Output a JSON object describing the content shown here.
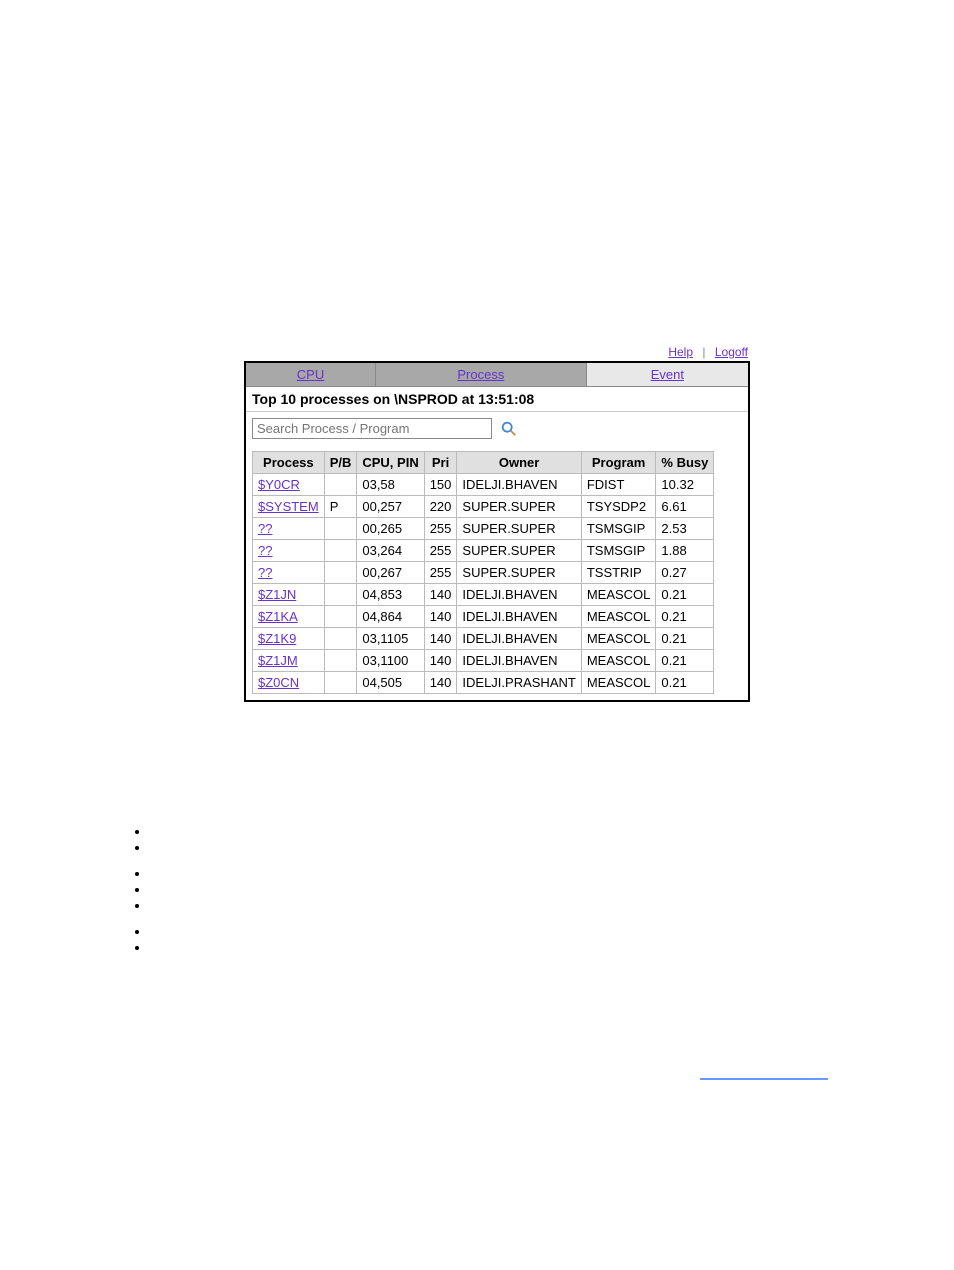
{
  "top_links": {
    "help": "Help",
    "logoff": "Logoff"
  },
  "tabs": {
    "cpu": "CPU",
    "process": "Process",
    "event": "Event"
  },
  "title": "Top 10 processes on \\NSPROD at 13:51:08",
  "search": {
    "placeholder": "Search Process / Program"
  },
  "columns": {
    "process": "Process",
    "pb": "P/B",
    "cpu_pin": "CPU, PIN",
    "pri": "Pri",
    "owner": "Owner",
    "program": "Program",
    "pct_busy": "% Busy"
  },
  "rows": [
    {
      "process": "$Y0CR",
      "pb": "",
      "cpu_pin": "03,58",
      "pri": "150",
      "owner": "IDELJI.BHAVEN",
      "program": "FDIST",
      "pct_busy": "10.32"
    },
    {
      "process": "$SYSTEM",
      "pb": "P",
      "cpu_pin": "00,257",
      "pri": "220",
      "owner": "SUPER.SUPER",
      "program": "TSYSDP2",
      "pct_busy": "6.61"
    },
    {
      "process": "??",
      "pb": "",
      "cpu_pin": "00,265",
      "pri": "255",
      "owner": "SUPER.SUPER",
      "program": "TSMSGIP",
      "pct_busy": "2.53"
    },
    {
      "process": "??",
      "pb": "",
      "cpu_pin": "03,264",
      "pri": "255",
      "owner": "SUPER.SUPER",
      "program": "TSMSGIP",
      "pct_busy": "1.88"
    },
    {
      "process": "??",
      "pb": "",
      "cpu_pin": "00,267",
      "pri": "255",
      "owner": "SUPER.SUPER",
      "program": "TSSTRIP",
      "pct_busy": "0.27"
    },
    {
      "process": "$Z1JN",
      "pb": "",
      "cpu_pin": "04,853",
      "pri": "140",
      "owner": "IDELJI.BHAVEN",
      "program": "MEASCOL",
      "pct_busy": "0.21"
    },
    {
      "process": "$Z1KA",
      "pb": "",
      "cpu_pin": "04,864",
      "pri": "140",
      "owner": "IDELJI.BHAVEN",
      "program": "MEASCOL",
      "pct_busy": "0.21"
    },
    {
      "process": "$Z1K9",
      "pb": "",
      "cpu_pin": "03,1105",
      "pri": "140",
      "owner": "IDELJI.BHAVEN",
      "program": "MEASCOL",
      "pct_busy": "0.21"
    },
    {
      "process": "$Z1JM",
      "pb": "",
      "cpu_pin": "03,1100",
      "pri": "140",
      "owner": "IDELJI.BHAVEN",
      "program": "MEASCOL",
      "pct_busy": "0.21"
    },
    {
      "process": "$Z0CN",
      "pb": "",
      "cpu_pin": "04,505",
      "pri": "140",
      "owner": "IDELJI.PRASHANT",
      "program": "MEASCOL",
      "pct_busy": "0.21"
    }
  ]
}
